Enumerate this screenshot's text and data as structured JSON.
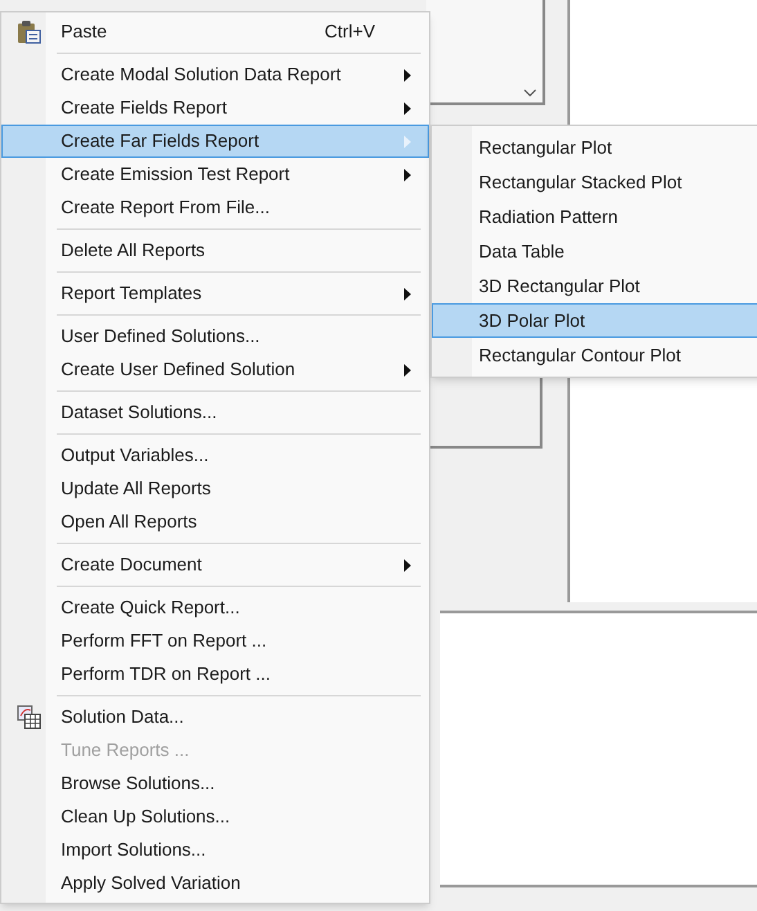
{
  "context_menu": {
    "items": [
      {
        "kind": "command",
        "label": "Paste",
        "shortcut": "Ctrl+V",
        "icon": true,
        "selected": false,
        "disabled": false
      },
      {
        "kind": "separator"
      },
      {
        "kind": "submenu",
        "label": "Create Modal Solution Data Report",
        "selected": false,
        "disabled": false
      },
      {
        "kind": "submenu",
        "label": "Create Fields Report",
        "selected": false,
        "disabled": false
      },
      {
        "kind": "submenu",
        "label": "Create Far Fields Report",
        "selected": true,
        "disabled": false
      },
      {
        "kind": "submenu",
        "label": "Create Emission Test Report",
        "selected": false,
        "disabled": false
      },
      {
        "kind": "command",
        "label": "Create Report From File...",
        "selected": false,
        "disabled": false
      },
      {
        "kind": "separator"
      },
      {
        "kind": "command",
        "label": "Delete All Reports",
        "selected": false,
        "disabled": false
      },
      {
        "kind": "separator"
      },
      {
        "kind": "submenu",
        "label": "Report Templates",
        "selected": false,
        "disabled": false
      },
      {
        "kind": "separator"
      },
      {
        "kind": "command",
        "label": "User Defined Solutions...",
        "selected": false,
        "disabled": false
      },
      {
        "kind": "submenu",
        "label": "Create User Defined Solution",
        "selected": false,
        "disabled": false
      },
      {
        "kind": "separator"
      },
      {
        "kind": "command",
        "label": "Dataset Solutions...",
        "selected": false,
        "disabled": false
      },
      {
        "kind": "separator"
      },
      {
        "kind": "command",
        "label": "Output Variables...",
        "selected": false,
        "disabled": false
      },
      {
        "kind": "command",
        "label": "Update All Reports",
        "selected": false,
        "disabled": false
      },
      {
        "kind": "command",
        "label": "Open All Reports",
        "selected": false,
        "disabled": false
      },
      {
        "kind": "separator"
      },
      {
        "kind": "submenu",
        "label": "Create Document",
        "selected": false,
        "disabled": false
      },
      {
        "kind": "separator"
      },
      {
        "kind": "command",
        "label": "Create Quick Report...",
        "selected": false,
        "disabled": false
      },
      {
        "kind": "command",
        "label": "Perform FFT on Report ...",
        "selected": false,
        "disabled": false
      },
      {
        "kind": "command",
        "label": "Perform TDR on Report ...",
        "selected": false,
        "disabled": false
      },
      {
        "kind": "separator"
      },
      {
        "kind": "command",
        "label": "Solution Data...",
        "icon": true,
        "selected": false,
        "disabled": false
      },
      {
        "kind": "command",
        "label": "Tune Reports ...",
        "selected": false,
        "disabled": true
      },
      {
        "kind": "command",
        "label": "Browse Solutions...",
        "selected": false,
        "disabled": false
      },
      {
        "kind": "command",
        "label": "Clean Up Solutions...",
        "selected": false,
        "disabled": false
      },
      {
        "kind": "command",
        "label": "Import Solutions...",
        "selected": false,
        "disabled": false
      },
      {
        "kind": "command",
        "label": "Apply Solved Variation",
        "selected": false,
        "disabled": false
      }
    ]
  },
  "submenu": {
    "items": [
      {
        "label": "Rectangular Plot",
        "selected": false
      },
      {
        "label": "Rectangular Stacked Plot",
        "selected": false
      },
      {
        "label": "Radiation Pattern",
        "selected": false
      },
      {
        "label": "Data Table",
        "selected": false
      },
      {
        "label": "3D Rectangular Plot",
        "selected": false
      },
      {
        "label": "3D Polar Plot",
        "selected": true
      },
      {
        "label": "Rectangular Contour Plot",
        "selected": false
      }
    ]
  }
}
